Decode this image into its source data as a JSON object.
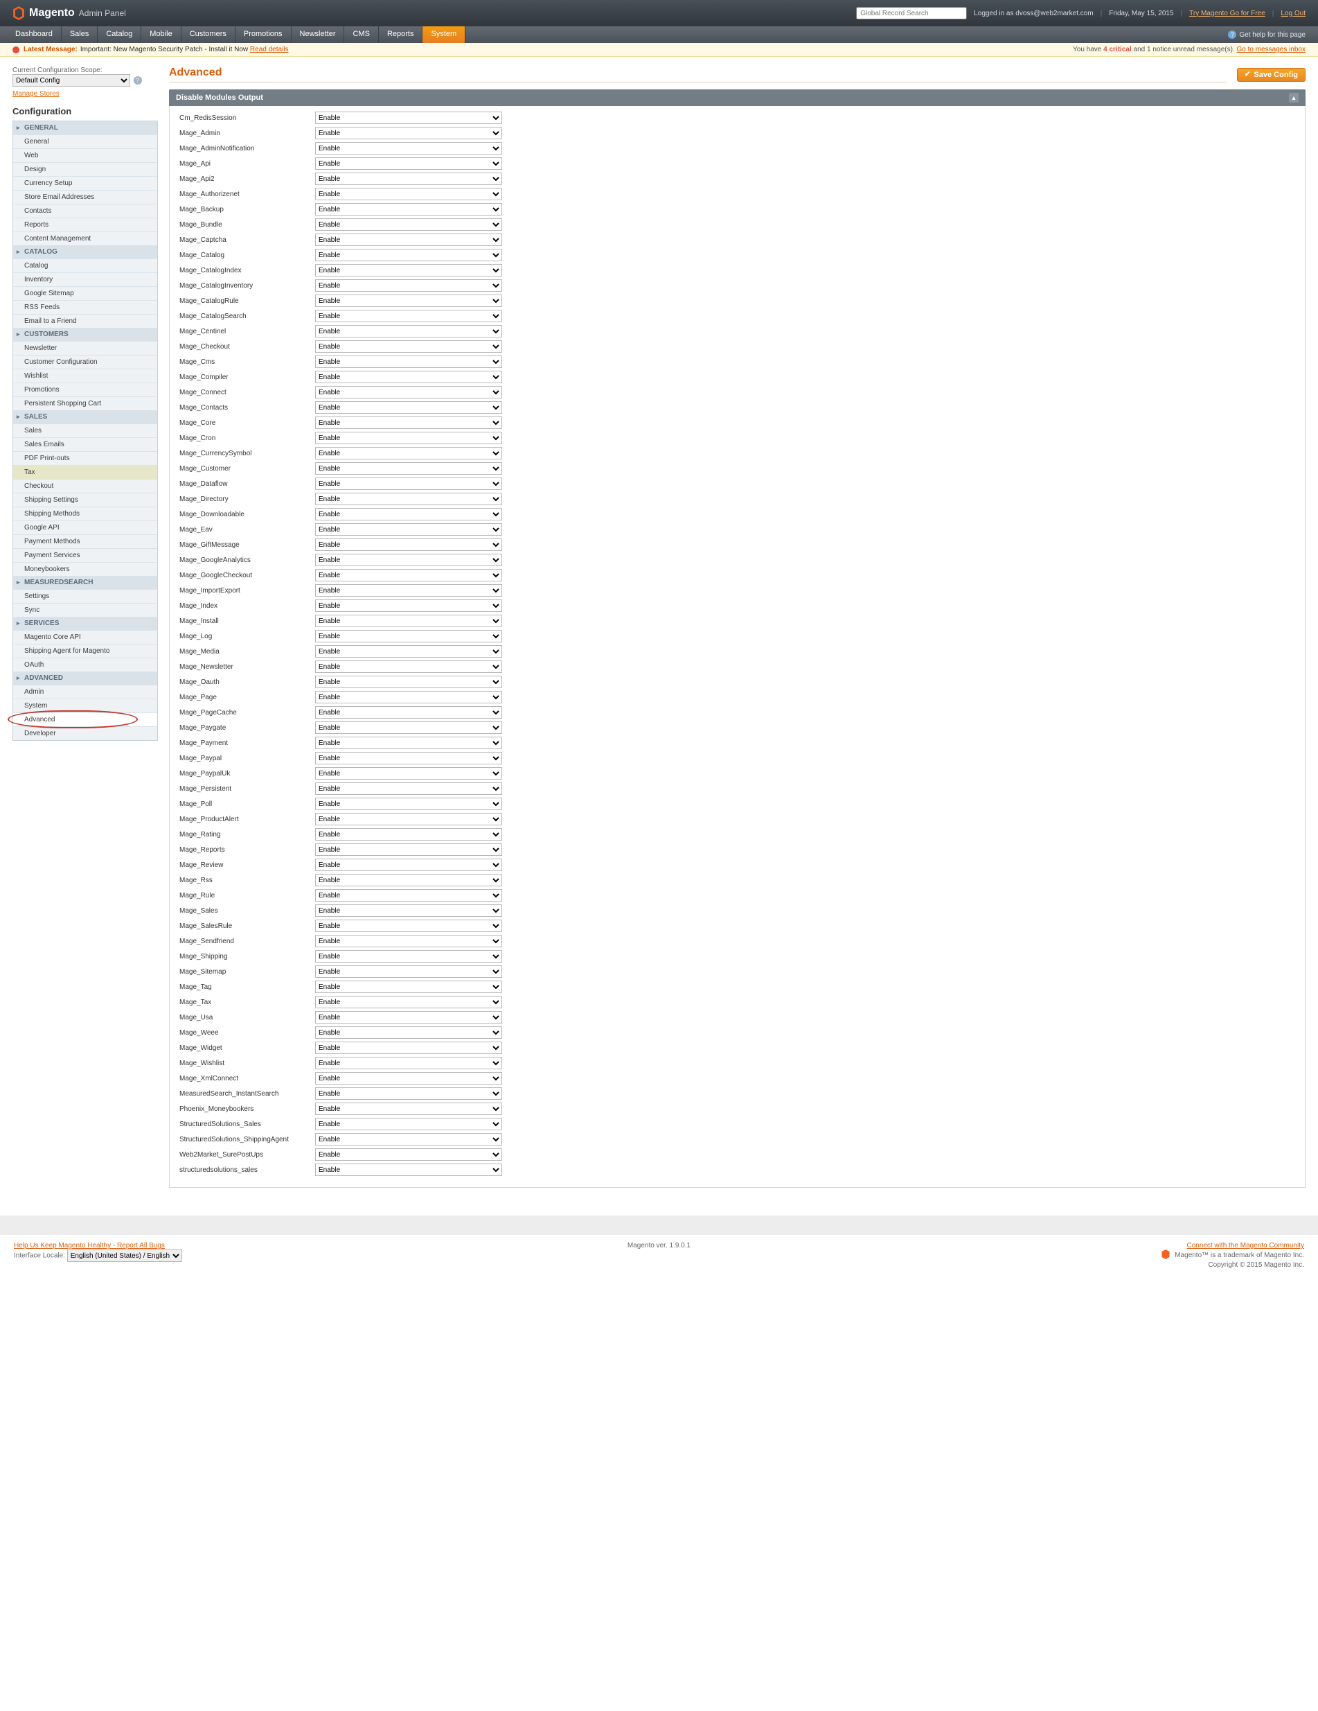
{
  "header": {
    "logo_main": "Magento",
    "logo_sub": "Admin Panel",
    "search_placeholder": "Global Record Search",
    "logged_in_prefix": "Logged in as",
    "user": "dvoss@web2market.com",
    "date": "Friday, May 15, 2015",
    "try_link": "Try Magento Go for Free",
    "logout": "Log Out"
  },
  "nav": {
    "tabs": [
      "Dashboard",
      "Sales",
      "Catalog",
      "Mobile",
      "Customers",
      "Promotions",
      "Newsletter",
      "CMS",
      "Reports",
      "System"
    ],
    "active": "System",
    "help": "Get help for this page"
  },
  "notice": {
    "lead": "Latest Message:",
    "text": "Important: New Magento Security Patch - Install it Now",
    "read": "Read details",
    "right_a": "You have",
    "right_count": "4 critical",
    "right_b": "and 1 notice unread message(s).",
    "right_link": "Go to messages inbox"
  },
  "scope": {
    "label": "Current Configuration Scope:",
    "value": "Default Config",
    "manage": "Manage Stores"
  },
  "config": {
    "title": "Configuration",
    "sections": [
      {
        "name": "GENERAL",
        "items": [
          "General",
          "Web",
          "Design",
          "Currency Setup",
          "Store Email Addresses",
          "Contacts",
          "Reports",
          "Content Management"
        ]
      },
      {
        "name": "CATALOG",
        "items": [
          "Catalog",
          "Inventory",
          "Google Sitemap",
          "RSS Feeds",
          "Email to a Friend"
        ]
      },
      {
        "name": "CUSTOMERS",
        "items": [
          "Newsletter",
          "Customer Configuration",
          "Wishlist",
          "Promotions",
          "Persistent Shopping Cart"
        ]
      },
      {
        "name": "SALES",
        "items": [
          "Sales",
          "Sales Emails",
          "PDF Print-outs",
          "Tax",
          "Checkout",
          "Shipping Settings",
          "Shipping Methods",
          "Google API",
          "Payment Methods",
          "Payment Services",
          "Moneybookers"
        ]
      },
      {
        "name": "MEASUREDSEARCH",
        "items": [
          "Settings",
          "Sync"
        ]
      },
      {
        "name": "SERVICES",
        "items": [
          "Magento Core API",
          "Shipping Agent for Magento",
          "OAuth"
        ]
      },
      {
        "name": "ADVANCED",
        "items": [
          "Admin",
          "System",
          "Advanced",
          "Developer"
        ]
      }
    ],
    "active_item": "Advanced"
  },
  "page": {
    "title": "Advanced",
    "save_btn": "Save Config",
    "panel_title": "Disable Modules Output",
    "select_value": "Enable"
  },
  "modules": [
    "Cm_RedisSession",
    "Mage_Admin",
    "Mage_AdminNotification",
    "Mage_Api",
    "Mage_Api2",
    "Mage_Authorizenet",
    "Mage_Backup",
    "Mage_Bundle",
    "Mage_Captcha",
    "Mage_Catalog",
    "Mage_CatalogIndex",
    "Mage_CatalogInventory",
    "Mage_CatalogRule",
    "Mage_CatalogSearch",
    "Mage_Centinel",
    "Mage_Checkout",
    "Mage_Cms",
    "Mage_Compiler",
    "Mage_Connect",
    "Mage_Contacts",
    "Mage_Core",
    "Mage_Cron",
    "Mage_CurrencySymbol",
    "Mage_Customer",
    "Mage_Dataflow",
    "Mage_Directory",
    "Mage_Downloadable",
    "Mage_Eav",
    "Mage_GiftMessage",
    "Mage_GoogleAnalytics",
    "Mage_GoogleCheckout",
    "Mage_ImportExport",
    "Mage_Index",
    "Mage_Install",
    "Mage_Log",
    "Mage_Media",
    "Mage_Newsletter",
    "Mage_Oauth",
    "Mage_Page",
    "Mage_PageCache",
    "Mage_Paygate",
    "Mage_Payment",
    "Mage_Paypal",
    "Mage_PaypalUk",
    "Mage_Persistent",
    "Mage_Poll",
    "Mage_ProductAlert",
    "Mage_Rating",
    "Mage_Reports",
    "Mage_Review",
    "Mage_Rss",
    "Mage_Rule",
    "Mage_Sales",
    "Mage_SalesRule",
    "Mage_Sendfriend",
    "Mage_Shipping",
    "Mage_Sitemap",
    "Mage_Tag",
    "Mage_Tax",
    "Mage_Usa",
    "Mage_Weee",
    "Mage_Widget",
    "Mage_Wishlist",
    "Mage_XmlConnect",
    "MeasuredSearch_InstantSearch",
    "Phoenix_Moneybookers",
    "StructuredSolutions_Sales",
    "StructuredSolutions_ShippingAgent",
    "Web2Market_SurePostUps",
    "structuredsolutions_sales"
  ],
  "footer": {
    "help_link": "Help Us Keep Magento Healthy - Report All Bugs",
    "locale_label": "Interface Locale:",
    "locale_value": "English (United States) / English",
    "version": "Magento ver. 1.9.0.1",
    "connect": "Connect with the Magento Community",
    "trademark": "Magento™ is a trademark of Magento Inc.",
    "copyright": "Copyright © 2015 Magento Inc."
  }
}
